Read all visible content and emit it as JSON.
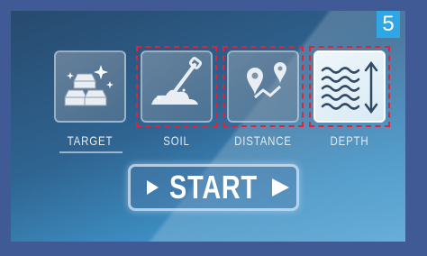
{
  "step_badge": "5",
  "modes": [
    {
      "label": "TARGET",
      "icon": "gold-bars-icon",
      "active": false,
      "highlighted": false
    },
    {
      "label": "SOIL",
      "icon": "shovel-icon",
      "active": false,
      "highlighted": true
    },
    {
      "label": "DISTANCE",
      "icon": "route-pins-icon",
      "active": false,
      "highlighted": true
    },
    {
      "label": "DEPTH",
      "icon": "waves-depth-icon",
      "active": true,
      "highlighted": true
    }
  ],
  "start_label": "START",
  "colors": {
    "frame": "#3f5a95",
    "badge": "#2ea7e4",
    "highlight": "#e0233d",
    "label": "#e4ecf3"
  }
}
